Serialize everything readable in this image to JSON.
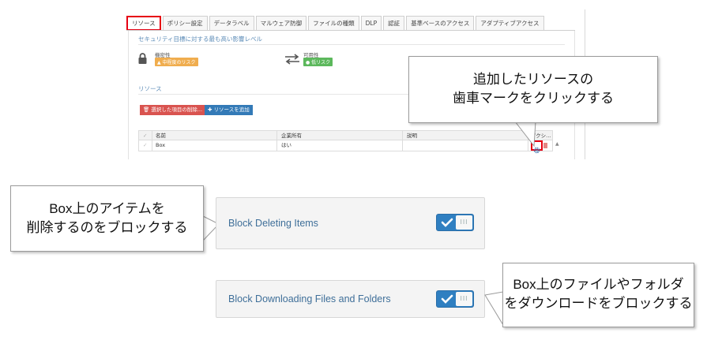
{
  "tabs": [
    {
      "label": "リソース",
      "active": true
    },
    {
      "label": "ポリシー設定",
      "active": false
    },
    {
      "label": "データラベル",
      "active": false
    },
    {
      "label": "マルウェア防御",
      "active": false
    },
    {
      "label": "ファイルの種類",
      "active": false
    },
    {
      "label": "DLP",
      "active": false
    },
    {
      "label": "認証",
      "active": false
    },
    {
      "label": "基準ベースのアクセス",
      "active": false
    },
    {
      "label": "アダプティブアクセス",
      "active": false
    }
  ],
  "security": {
    "title": "セキュリティ目標に対する最も高い影響レベル",
    "confidentiality_label": "機密性",
    "confidentiality_badge": "中程度のリスク",
    "availability_label": "可用性",
    "availability_badge": "低リスク"
  },
  "resources": {
    "title": "リソース",
    "delete_button": "選択した項目の削除...",
    "add_button": "リソースを追加",
    "columns": [
      "名前",
      "企業所有",
      "説明",
      "アクシ..."
    ],
    "rows": [
      {
        "name": "Box",
        "owned": "はい",
        "description": ""
      }
    ]
  },
  "callouts": {
    "gear": [
      "追加したリソースの",
      "歯車マークをクリックする"
    ],
    "delete": [
      "Box上のアイテムを",
      "削除するのをブロックする"
    ],
    "download": [
      "Box上のファイルやフォルダ",
      "をダウンロードをブロックする"
    ]
  },
  "settings": {
    "block_deleting_label": "Block Deleting Items",
    "block_downloading_label": "Block Downloading Files and Folders",
    "toggle_knob_text": "III"
  },
  "colors": {
    "highlight": "#e60012",
    "accent": "#2f7fc1",
    "link_text": "#3f6f99",
    "medium_risk": "#f0ad4e",
    "low_risk": "#5cb85c"
  }
}
